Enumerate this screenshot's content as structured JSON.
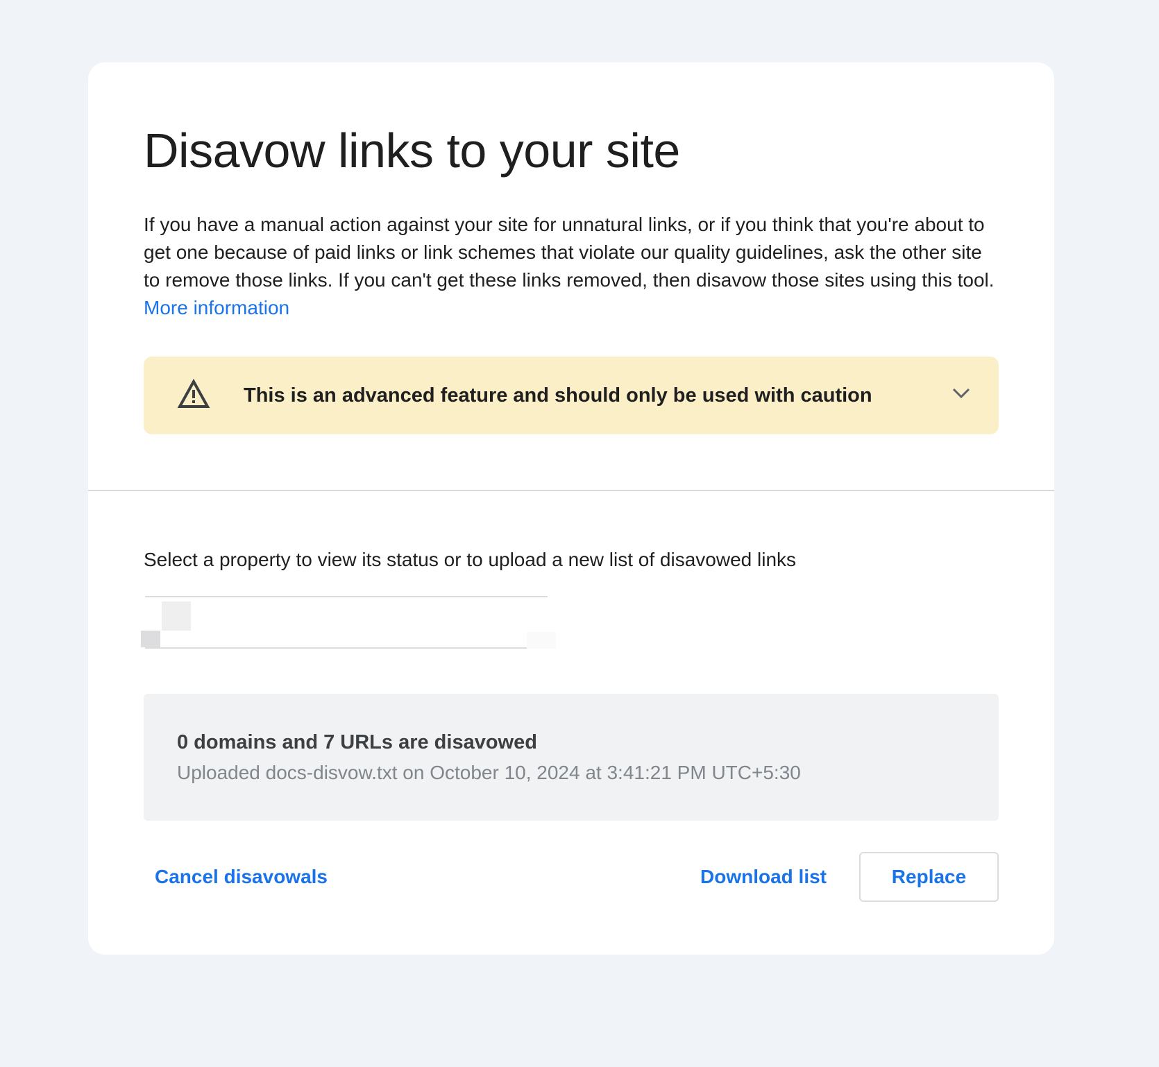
{
  "page": {
    "title": "Disavow links to your site",
    "intro_text": "If you have a manual action against your site for unnatural links, or if you think that you're about to get one because of paid links or link schemes that violate our quality guidelines, ask the other site to remove those links. If you can't get these links removed, then disavow those sites using this tool.",
    "intro_link": "More information"
  },
  "warning": {
    "text": "This is an advanced feature and should only be used with caution",
    "icon": "warning-triangle-icon",
    "expand_icon": "chevron-down-icon",
    "background": "#fbefc8"
  },
  "property": {
    "label": "Select a property to view its status or to upload a new list of disavowed links",
    "selected_value": ""
  },
  "status": {
    "title": "0 domains and 7 URLs are disavowed",
    "subtitle": "Uploaded docs-disvow.txt on October 10, 2024 at 3:41:21 PM UTC+5:30"
  },
  "actions": {
    "cancel_label": "Cancel disavowals",
    "download_label": "Download list",
    "replace_label": "Replace"
  },
  "colors": {
    "accent": "#1a73e8",
    "page_background": "#f0f4f9",
    "card_background": "#ffffff",
    "status_background": "#f1f2f4"
  }
}
